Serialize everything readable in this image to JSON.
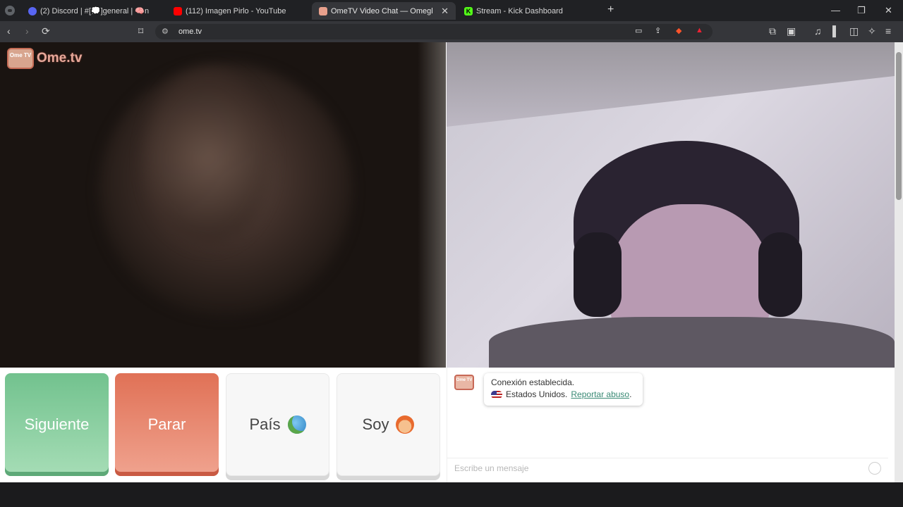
{
  "tabs": [
    {
      "title": "(2) Discord | #[💭]general | 🧠n",
      "active": false
    },
    {
      "title": "(112) Imagen Pirlo - YouTube",
      "active": false
    },
    {
      "title": "OmeTV Video Chat — Omegl",
      "active": true
    },
    {
      "title": "Stream - Kick Dashboard",
      "active": false
    }
  ],
  "new_tab": "+",
  "toolbar": {
    "url": "ome.tv"
  },
  "window_controls": {
    "minimize": "—",
    "restore": "❐",
    "close": "✕"
  },
  "site": {
    "logo_text": "Ome.tv",
    "logo_tv_text": "Ome TV"
  },
  "controls": {
    "next": "Siguiente",
    "stop": "Parar",
    "country": "País",
    "gender": "Soy"
  },
  "chat": {
    "logo_tv_text": "Ome TV",
    "connected": "Conexión establecida.",
    "country": "Estados Unidos.",
    "report": "Reportar abuso",
    "report_suffix": ".",
    "placeholder": "Escribe un mensaje"
  },
  "colors": {
    "next": "#72c28e",
    "stop": "#e07156",
    "link": "#3a8a75"
  }
}
